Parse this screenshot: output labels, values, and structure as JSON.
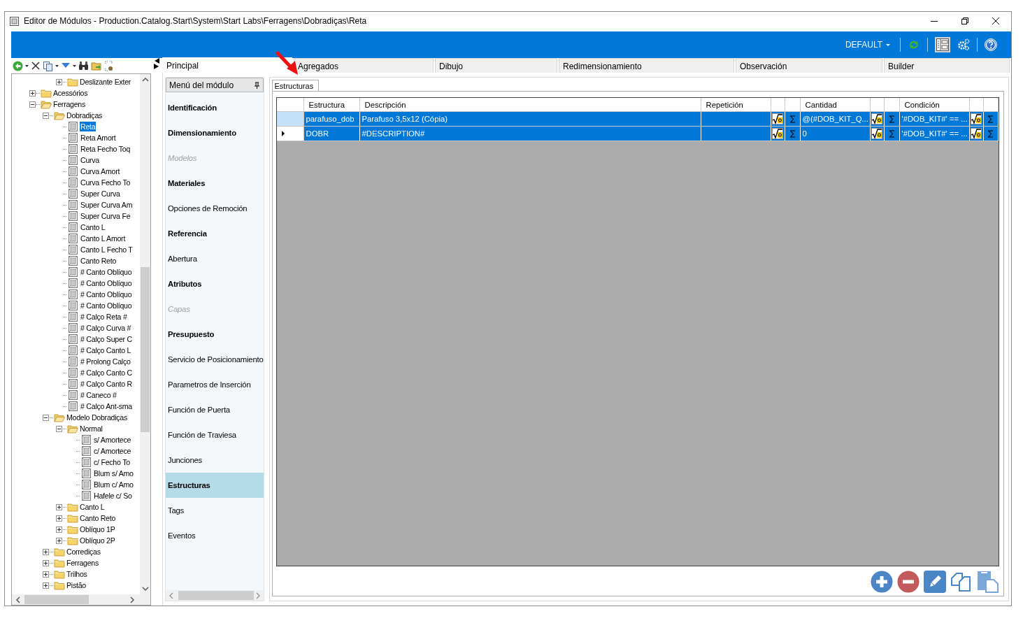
{
  "window": {
    "title": "Editor de Módulos - Production.Catalog.Start\\System\\Start Labs\\Ferragens\\Dobradiças\\Reta"
  },
  "top_bar": {
    "profile": "DEFAULT",
    "layout_selected": true
  },
  "tree": {
    "partial_branch": [
      {
        "label": "Deslizante Exter",
        "kind": "folder",
        "expanded": false,
        "selected": false
      }
    ],
    "items": [
      {
        "label": "Acessórios",
        "kind": "folder",
        "expanded": false,
        "selected": false
      },
      {
        "label": "Ferragens",
        "kind": "folder",
        "expanded": true,
        "selected": false,
        "children": [
          {
            "label": "Dobradiças",
            "kind": "folder",
            "expanded": true,
            "selected": false,
            "children": [
              {
                "label": "Reta",
                "kind": "module",
                "selected": true
              },
              {
                "label": "Reta Amort",
                "kind": "module",
                "selected": false
              },
              {
                "label": "Reta Fecho Toq",
                "kind": "module",
                "selected": false
              },
              {
                "label": "Curva",
                "kind": "module",
                "selected": false
              },
              {
                "label": "Curva Amort",
                "kind": "module",
                "selected": false
              },
              {
                "label": "Curva Fecho To",
                "kind": "module",
                "selected": false
              },
              {
                "label": "Super Curva",
                "kind": "module",
                "selected": false
              },
              {
                "label": "Super Curva Am",
                "kind": "module",
                "selected": false
              },
              {
                "label": "Super Curva Fe",
                "kind": "module",
                "selected": false
              },
              {
                "label": "Canto L",
                "kind": "module",
                "selected": false
              },
              {
                "label": "Canto L Amort",
                "kind": "module",
                "selected": false
              },
              {
                "label": "Canto L Fecho T",
                "kind": "module",
                "selected": false
              },
              {
                "label": "Canto Reto",
                "kind": "module",
                "selected": false
              },
              {
                "label": "# Canto Oblíquo",
                "kind": "module",
                "selected": false
              },
              {
                "label": "# Canto Oblíquo",
                "kind": "module",
                "selected": false
              },
              {
                "label": "# Canto Oblíquo",
                "kind": "module",
                "selected": false
              },
              {
                "label": "# Canto Oblíquo",
                "kind": "module",
                "selected": false
              },
              {
                "label": "# Calço Reta #",
                "kind": "module",
                "selected": false
              },
              {
                "label": "# Calço Curva #",
                "kind": "module",
                "selected": false
              },
              {
                "label": "# Calço Super C",
                "kind": "module",
                "selected": false
              },
              {
                "label": "# Calço Canto L",
                "kind": "module",
                "selected": false
              },
              {
                "label": "# Prolong Calço",
                "kind": "module",
                "selected": false
              },
              {
                "label": "# Calço Canto C",
                "kind": "module",
                "selected": false
              },
              {
                "label": "# Calço Canto R",
                "kind": "module",
                "selected": false
              },
              {
                "label": "# Caneco #",
                "kind": "module",
                "selected": false
              },
              {
                "label": "# Calço Ant-sma",
                "kind": "module",
                "selected": false
              }
            ]
          },
          {
            "label": "Modelo Dobradiças",
            "kind": "folder",
            "expanded": true,
            "selected": false,
            "children": [
              {
                "label": "Normal",
                "kind": "folder",
                "expanded": true,
                "selected": false,
                "children": [
                  {
                    "label": "s/ Amortece",
                    "kind": "module",
                    "selected": false
                  },
                  {
                    "label": "c/ Amortece",
                    "kind": "module",
                    "selected": false
                  },
                  {
                    "label": "c/ Fecho To",
                    "kind": "module",
                    "selected": false
                  },
                  {
                    "label": "Blum s/ Amo",
                    "kind": "module",
                    "selected": false
                  },
                  {
                    "label": "Blum c/ Amo",
                    "kind": "module",
                    "selected": false
                  },
                  {
                    "label": "Hafele c/ So",
                    "kind": "module",
                    "selected": false
                  }
                ]
              },
              {
                "label": "Canto L",
                "kind": "folder",
                "expanded": false,
                "selected": false
              },
              {
                "label": "Canto Reto",
                "kind": "folder",
                "expanded": false,
                "selected": false
              },
              {
                "label": "Oblíquo 1P",
                "kind": "folder",
                "expanded": false,
                "selected": false
              },
              {
                "label": "Oblíquo 2P",
                "kind": "folder",
                "expanded": false,
                "selected": false
              }
            ]
          },
          {
            "label": "Corrediças",
            "kind": "folder",
            "expanded": false,
            "selected": false
          },
          {
            "label": "Ferragens",
            "kind": "folder",
            "expanded": false,
            "selected": false
          },
          {
            "label": "Trilhos",
            "kind": "folder",
            "expanded": false,
            "selected": false
          },
          {
            "label": "Pistão",
            "kind": "folder",
            "expanded": false,
            "selected": false
          }
        ]
      }
    ]
  },
  "tabs": [
    {
      "label": "Principal",
      "selected": true
    },
    {
      "label": "Agregados",
      "selected": false
    },
    {
      "label": "Dibujo",
      "selected": false
    },
    {
      "label": "Redimensionamiento",
      "selected": false
    },
    {
      "label": "Observación",
      "selected": false
    },
    {
      "label": "Builder",
      "selected": false
    }
  ],
  "module_menu": {
    "title": "Menú del módulo",
    "items": [
      {
        "label": "Identificación",
        "bold": true,
        "disabled": false,
        "selected": false
      },
      {
        "label": "Dimensionamiento",
        "bold": true,
        "disabled": false,
        "selected": false
      },
      {
        "label": "Modelos",
        "bold": false,
        "disabled": true,
        "selected": false
      },
      {
        "label": "Materiales",
        "bold": true,
        "disabled": false,
        "selected": false
      },
      {
        "label": "Opciones de Remoción",
        "bold": false,
        "disabled": false,
        "selected": false
      },
      {
        "label": "Referencia",
        "bold": true,
        "disabled": false,
        "selected": false
      },
      {
        "label": "Abertura",
        "bold": false,
        "disabled": false,
        "selected": false
      },
      {
        "label": "Atributos",
        "bold": true,
        "disabled": false,
        "selected": false
      },
      {
        "label": "Capas",
        "bold": false,
        "disabled": true,
        "selected": false
      },
      {
        "label": "Presupuesto",
        "bold": true,
        "disabled": false,
        "selected": false
      },
      {
        "label": "Servicio de Posicionamiento",
        "bold": false,
        "disabled": false,
        "selected": false
      },
      {
        "label": "Parametros de Inserción",
        "bold": false,
        "disabled": false,
        "selected": false
      },
      {
        "label": "Función de Puerta",
        "bold": false,
        "disabled": false,
        "selected": false
      },
      {
        "label": "Función de Traviesa",
        "bold": false,
        "disabled": false,
        "selected": false
      },
      {
        "label": "Junciones",
        "bold": false,
        "disabled": false,
        "selected": false
      },
      {
        "label": "Estructuras",
        "bold": true,
        "disabled": false,
        "selected": true
      },
      {
        "label": "Tags",
        "bold": false,
        "disabled": false,
        "selected": false
      },
      {
        "label": "Eventos",
        "bold": false,
        "disabled": false,
        "selected": false
      }
    ]
  },
  "content_tab": {
    "label": "Estructuras",
    "selected": true
  },
  "table": {
    "columns": [
      "Estructura",
      "Descripción",
      "Repetición",
      "Cantidad",
      "Condición"
    ],
    "rows": [
      {
        "selected": true,
        "current": false,
        "estructura": "parafuso_dob",
        "descripcion": "Parafuso 3,5x12 (Cópia)",
        "cantidad": "@(#DOB_KIT_Q...",
        "condicion": "'#DOB_KIT#' == ..."
      },
      {
        "selected": true,
        "current": true,
        "estructura": "DOBR",
        "descripcion": "#DESCRIPTION#",
        "cantidad": "0",
        "condicion": "'#DOB_KIT#' == ..."
      }
    ]
  }
}
